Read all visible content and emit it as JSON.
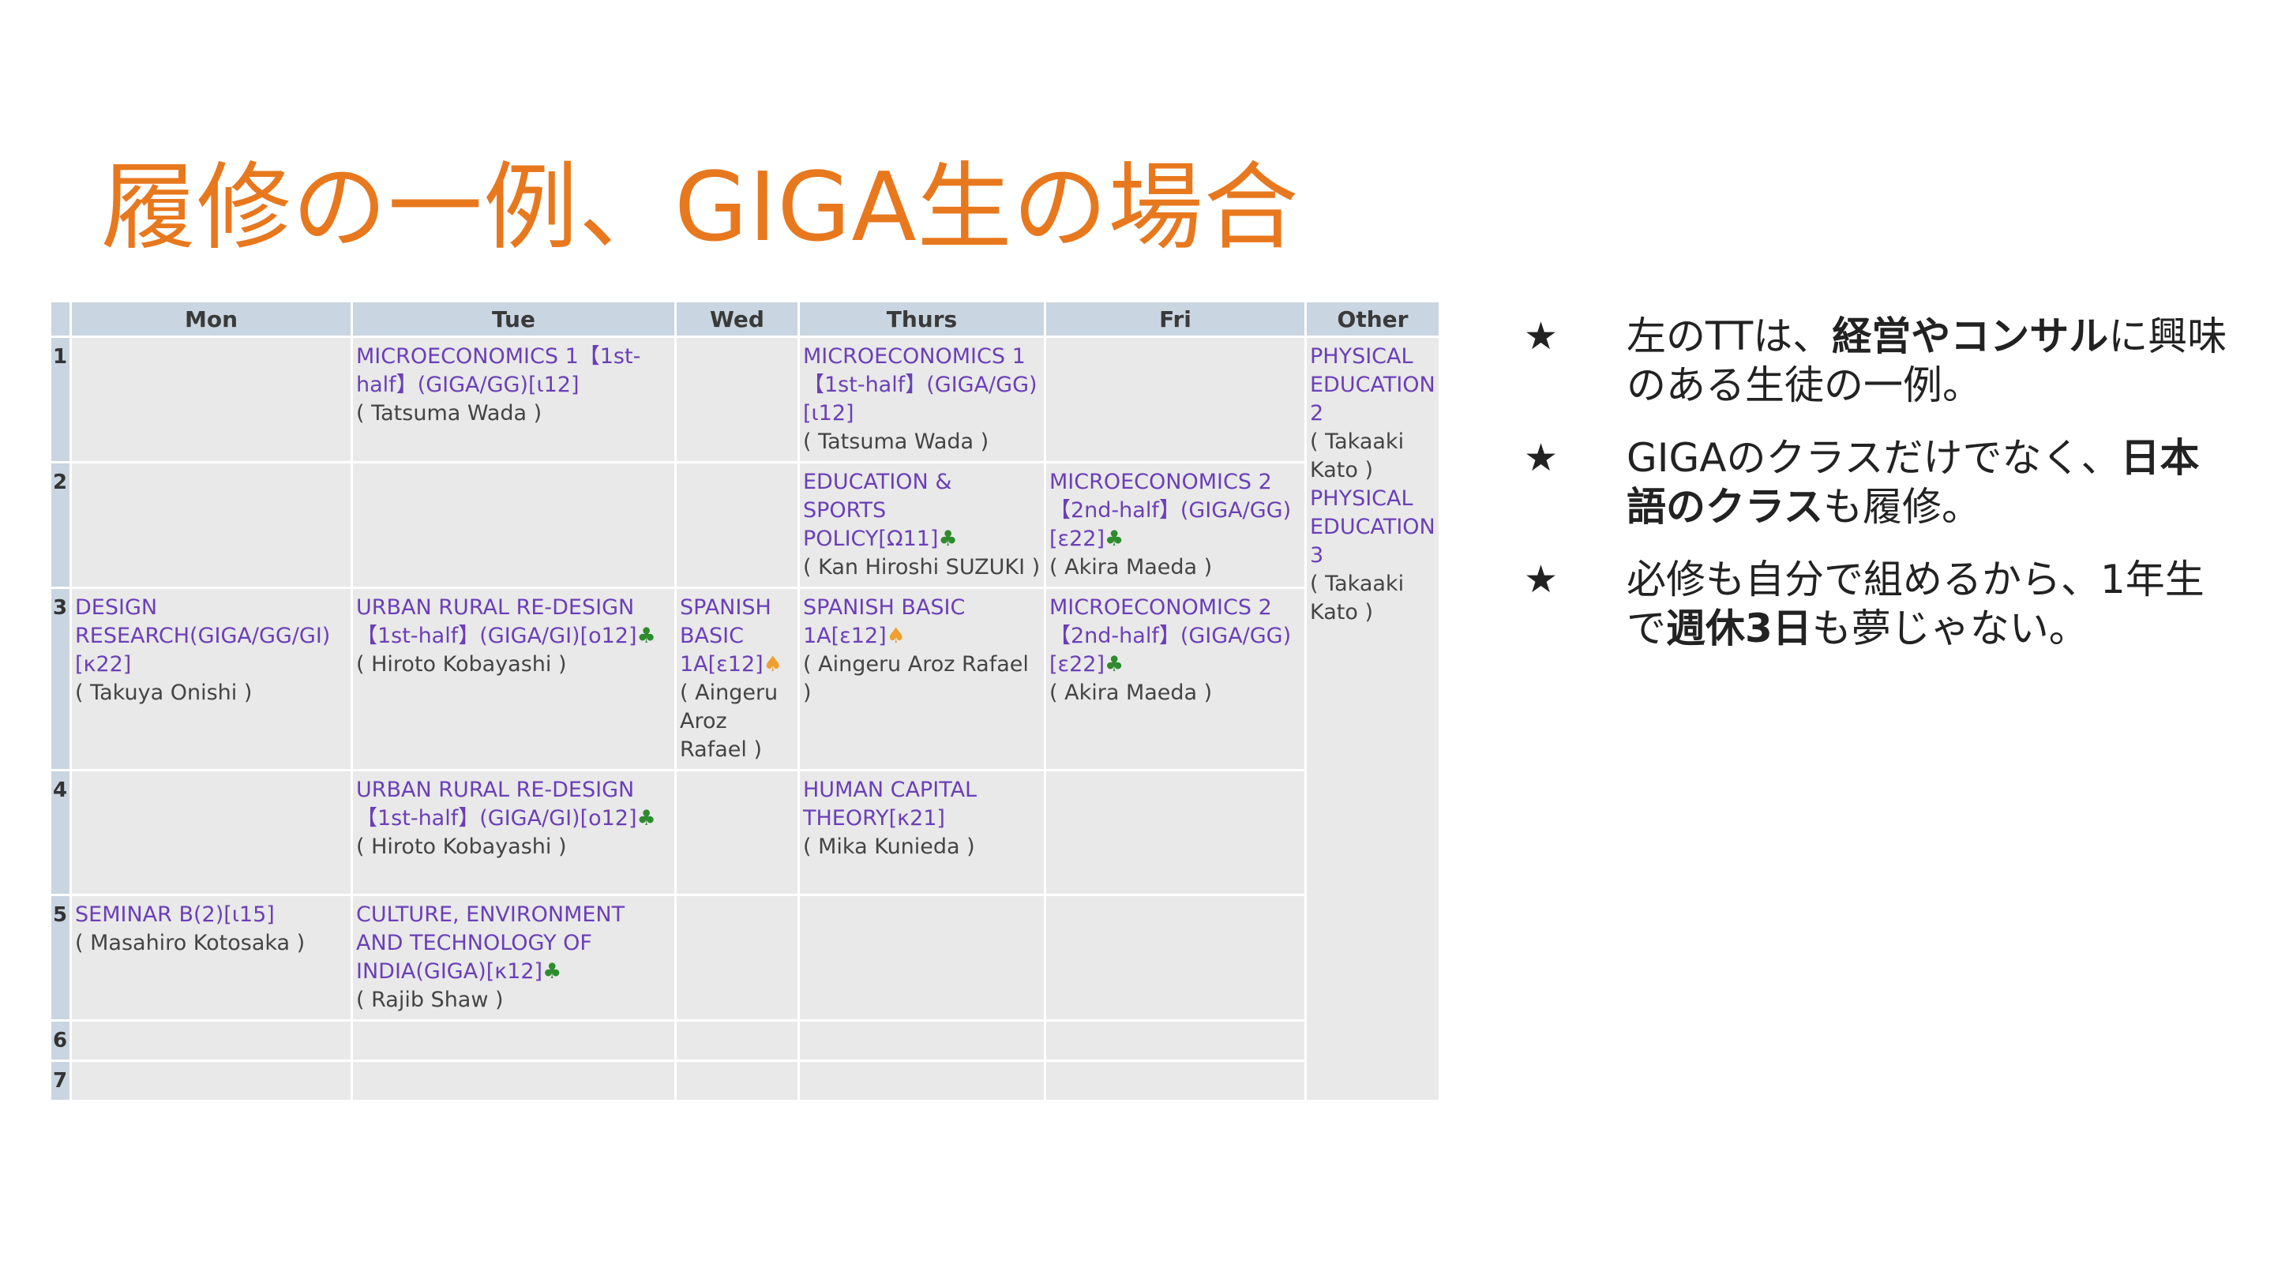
{
  "title": "履修の一例、GIGA生の場合",
  "timetable": {
    "days": [
      "Mon",
      "Tue",
      "Wed",
      "Thurs",
      "Fri",
      "Other"
    ],
    "periods": [
      "1",
      "2",
      "3",
      "4",
      "5",
      "6",
      "7"
    ],
    "cells": {
      "tue_p1": {
        "course": "MICROECONOMICS 1【1st-half】(GIGA/GG)[ι12]",
        "prof": "( Tatsuma Wada )"
      },
      "thu_p1": {
        "course": "MICROECONOMICS 1【1st-half】(GIGA/GG)[ι12]",
        "prof": "( Tatsuma Wada )"
      },
      "thu_p2": {
        "course": "EDUCATION & SPORTS POLICY[Ω11]",
        "mark": "♣",
        "prof": "( Kan Hiroshi SUZUKI )"
      },
      "fri_p2": {
        "course": "MICROECONOMICS 2【2nd-half】(GIGA/GG)[ε22]",
        "mark": "♣",
        "prof": "( Akira Maeda )"
      },
      "mon_p3": {
        "course": "DESIGN RESEARCH(GIGA/GG/GI)[κ22]",
        "prof": "( Takuya Onishi )"
      },
      "tue_p3": {
        "course": "URBAN RURAL RE-DESIGN【1st-half】(GIGA/GI)[o12]",
        "mark": "♣",
        "prof": "( Hiroto Kobayashi )"
      },
      "wed_p3": {
        "course": "SPANISH BASIC 1A[ε12]",
        "mark": "♠",
        "prof": "( Aingeru Aroz Rafael )"
      },
      "thu_p3": {
        "course": "SPANISH BASIC 1A[ε12]",
        "mark": "♠",
        "prof": "( Aingeru Aroz Rafael )"
      },
      "fri_p3": {
        "course": "MICROECONOMICS 2【2nd-half】(GIGA/GG)[ε22]",
        "mark": "♣",
        "prof": "( Akira Maeda )"
      },
      "tue_p4": {
        "course": "URBAN RURAL RE-DESIGN【1st-half】(GIGA/GI)[o12]",
        "mark": "♣",
        "prof": "( Hiroto Kobayashi )"
      },
      "thu_p4": {
        "course": "HUMAN CAPITAL THEORY[κ21]",
        "prof": "( Mika Kunieda )"
      },
      "mon_p5": {
        "course": "SEMINAR B(2)[ι15]",
        "prof": "( Masahiro Kotosaka )"
      },
      "tue_p5": {
        "course": "CULTURE, ENVIRONMENT AND TECHNOLOGY OF INDIA(GIGA)[κ12]",
        "mark": "♣",
        "prof": "( Rajib Shaw )"
      },
      "other": [
        {
          "course": "PHYSICAL EDUCATION 2",
          "prof": "( Takaaki Kato )"
        },
        {
          "course": "PHYSICAL EDUCATION 3",
          "prof": "( Takaaki Kato )"
        }
      ]
    }
  },
  "bullets": {
    "symbol": "★",
    "b1": {
      "pre": "左のTTは、",
      "bold": "経営やコンサル",
      "post": "に興味のある生徒の一例。"
    },
    "b2": {
      "pre": "GIGAのクラスだけでなく、",
      "bold": "日本語のクラス",
      "post": "も履修。"
    },
    "b3": {
      "pre": "必修も自分で組めるから、1年生で",
      "bold": "週休3日",
      "post": "も夢じゃない。"
    }
  }
}
